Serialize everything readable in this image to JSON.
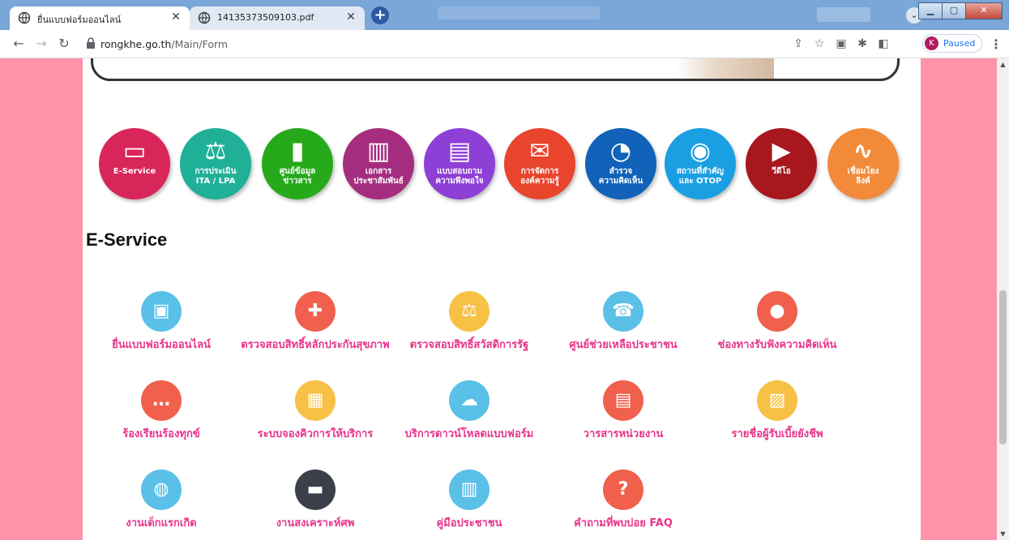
{
  "browser": {
    "tabs": [
      {
        "title": "ยื่นแบบฟอร์มออนไลน์",
        "active": true
      },
      {
        "title": "14135373509103.pdf",
        "active": false
      }
    ],
    "new_tab_label": "+",
    "address": {
      "host": "rongkhe.go.th",
      "path": "/Main/Form"
    },
    "profile": {
      "initial": "K",
      "status": "Paused"
    }
  },
  "menu_circles": [
    {
      "label": "E-Service",
      "icon": "monitor-icon",
      "color": "#d8265a"
    },
    {
      "label": "การประเมิน\nITA / LPA",
      "icon": "scales-icon",
      "color": "#20b098"
    },
    {
      "label": "ศูนย์ข้อมูล\nข่าวสาร",
      "icon": "bar-chart-icon",
      "color": "#27a91c"
    },
    {
      "label": "เอกสาร\nประชาสัมพันธ์",
      "icon": "book-icon",
      "color": "#a52d7f"
    },
    {
      "label": "แบบสอบถาม\nความพึงพอใจ",
      "icon": "document-icon",
      "color": "#8e3fd6"
    },
    {
      "label": "การจัดการ\nองค์ความรู้",
      "icon": "envelope-icon",
      "color": "#e8452c"
    },
    {
      "label": "สำรวจ\nความคิดเห็น",
      "icon": "pie-chart-icon",
      "color": "#1162b8"
    },
    {
      "label": "สถานที่สำคัญ\nและ OTOP",
      "icon": "map-pin-icon",
      "color": "#1a9fe3"
    },
    {
      "label": "วีดีโอ",
      "icon": "play-icon",
      "color": "#a8161e"
    },
    {
      "label": "เชื่อมโยง\nลิงค์",
      "icon": "link-icon",
      "color": "#f28a3a"
    }
  ],
  "section_title": "E-Service",
  "services": [
    {
      "label": "ยื่นแบบฟอร์มออนไลน์",
      "icon": "computer-form-icon",
      "color": "#5bc0e8"
    },
    {
      "label": "ตรวจสอบสิทธิ์หลักประกันสุขภาพ",
      "icon": "medical-cross-icon",
      "color": "#f0604d"
    },
    {
      "label": "ตรวจสอบสิทธิ์สวัสดิการรัฐ",
      "icon": "scales-icon",
      "color": "#f6c145"
    },
    {
      "label": "ศูนย์ช่วยเหลือประชาชน",
      "icon": "phone-icon",
      "color": "#5bc0e8"
    },
    {
      "label": "ช่องทางรับฟังความคิดเห็น",
      "icon": "lightbulb-icon",
      "color": "#f0604d"
    },
    {
      "label": "ร้องเรียนร้องทุกข์",
      "icon": "chat-bubble-icon",
      "color": "#f0604d"
    },
    {
      "label": "ระบบจองคิวการให้บริการ",
      "icon": "calendar-screen-icon",
      "color": "#f6c145"
    },
    {
      "label": "บริการดาวน์โหลดแบบฟอร์ม",
      "icon": "cloud-download-icon",
      "color": "#5bc0e8"
    },
    {
      "label": "วารสารหน่วยงาน",
      "icon": "newspaper-icon",
      "color": "#f0604d"
    },
    {
      "label": "รายชื่อผู้รับเบี้ยยังชีพ",
      "icon": "id-card-icon",
      "color": "#f6c145"
    },
    {
      "label": "งานเด็กแรกเกิด",
      "icon": "piggy-bank-icon",
      "color": "#5bc0e8"
    },
    {
      "label": "งานสงเคราะห์ศพ",
      "icon": "money-icon",
      "color": "#3a3f4a"
    },
    {
      "label": "คู่มือประชาชน",
      "icon": "open-book-icon",
      "color": "#5bc0e8"
    },
    {
      "label": "คำถามที่พบบ่อย FAQ",
      "icon": "question-icon",
      "color": "#f0604d"
    }
  ]
}
